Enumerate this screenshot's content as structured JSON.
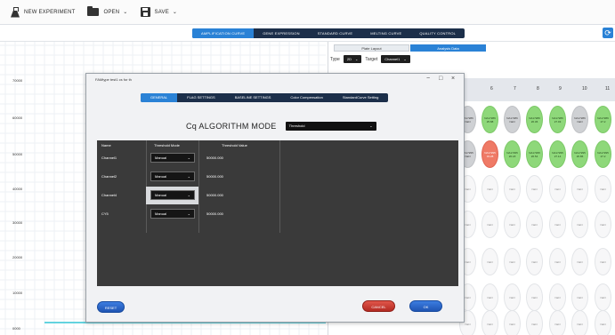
{
  "toolbar": {
    "new_experiment": "NEW EXPERIMENT",
    "open": "OPEN",
    "save": "SAVE",
    "new_icon": "flask-icon",
    "open_icon": "folder-icon",
    "save_icon": "save-disk-icon"
  },
  "main_tabs": [
    "AMPLIFICATION CURVE",
    "GENE EXPRESSION",
    "STANDARD CURVE",
    "MELTING CURVE",
    "QUALITY CONTROL"
  ],
  "main_tab_active": "AMPLIFICATION CURVE",
  "refresh_icon": "refresh-icon",
  "chart": {
    "y_ticks": [
      "70000",
      "60000",
      "50000",
      "40000",
      "30000",
      "20000",
      "10000",
      "0000"
    ]
  },
  "right_panel": {
    "sub_tabs": [
      "Plate Layout",
      "Analysis Data"
    ],
    "active_sub_tab": "Analysis Data",
    "type_label": "Type",
    "type_value": "2D",
    "target_label": "Target",
    "target_value": "Channel1",
    "column_numbers": [
      "6",
      "7",
      "8",
      "9",
      "10",
      "11"
    ],
    "wells_row1": [
      {
        "text": "NA17286 NaN",
        "color": "gr"
      },
      {
        "text": "NA17286 25.88",
        "color": "g"
      },
      {
        "text": "NA17286 NaN",
        "color": "gr"
      },
      {
        "text": "NA17286 26.36",
        "color": "g"
      },
      {
        "text": "NA17286 27.03",
        "color": "g"
      },
      {
        "text": "NA17286 NaN",
        "color": "gr"
      },
      {
        "text": "NA17286 27.2",
        "color": "g"
      }
    ],
    "wells_row2": [
      {
        "text": "NA17295 NaN",
        "color": "gr"
      },
      {
        "text": "NA17295 33.28",
        "color": "r"
      },
      {
        "text": "NA17295 26.18",
        "color": "g"
      },
      {
        "text": "NA17295 26.54",
        "color": "g"
      },
      {
        "text": "NA17295 27.14",
        "color": "g"
      },
      {
        "text": "NA17295 26.86",
        "color": "g"
      },
      {
        "text": "NA17295 27.2",
        "color": "g"
      }
    ],
    "empty_value": "NaN"
  },
  "dialog": {
    "title": "FAMtype test1 cs for th",
    "minimize": "−",
    "maximize": "□",
    "close": "×",
    "tabs": [
      "GENERAL",
      "FLAG SETTINGS",
      "BASELINE SETTINGS",
      "Color Compensation",
      "StandardCurve Setting"
    ],
    "active_tab": "GENERAL",
    "cq_label": "Cq ALGORITHM MODE",
    "algorithm": "Threshold",
    "columns": {
      "name": "Name",
      "mode": "Threshold Mode",
      "value": "Threshold Value"
    },
    "rows": [
      {
        "name": "Channel1",
        "mode": "Manual",
        "value": "50000.000"
      },
      {
        "name": "Channel2",
        "mode": "Manual",
        "value": "50000.000"
      },
      {
        "name": "Channel4",
        "mode": "Manual",
        "value": "50000.000"
      },
      {
        "name": "CY5",
        "mode": "Manual",
        "value": "50000.000"
      }
    ],
    "reset": "RESET",
    "cancel": "CANCEL",
    "ok": "OK"
  }
}
